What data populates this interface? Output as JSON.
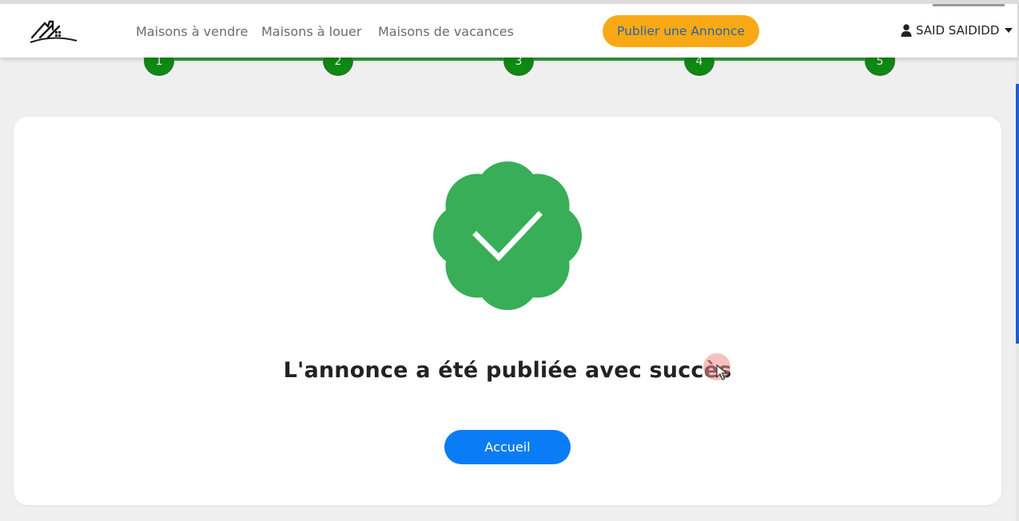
{
  "nav": {
    "links": [
      "Maisons à vendre",
      "Maisons à louer",
      "Maisons de vacances"
    ],
    "publish_label": "Publier une Annonce",
    "user_name": "SAID SAIDIDD"
  },
  "stepper": {
    "steps": [
      "1",
      "2",
      "3",
      "4",
      "5"
    ],
    "current": 5
  },
  "success": {
    "message": "L'annonce a été publiée avec succès",
    "button_label": "Accueil"
  },
  "icons": {
    "logo": "house-roof-logo-icon",
    "user": "user-icon",
    "success": "verified-badge-check-icon",
    "cursor": "mouse-cursor-icon"
  },
  "colors": {
    "accent_orange": "#f9a915",
    "publish_text": "#2a62a8",
    "step_green": "#0e8a12",
    "badge_green": "#38ae58",
    "primary_blue": "#0a7cf5"
  }
}
